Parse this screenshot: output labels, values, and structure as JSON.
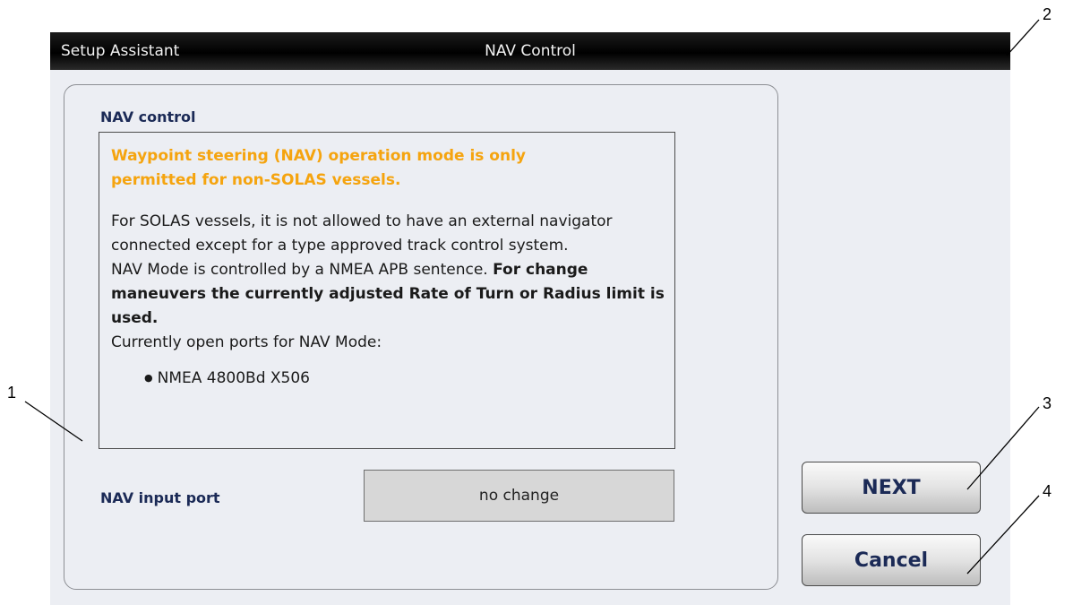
{
  "titlebar": {
    "left_title": "Setup Assistant",
    "center_title": "NAV Control"
  },
  "panel": {
    "section_title": "NAV control",
    "warning": "Waypoint steering (NAV) operation mode is only permitted for non-SOLAS vessels.",
    "paragraph1": "For SOLAS vessels, it is not allowed to have an external navigator connected except for a type approved track control system.",
    "paragraph2_normal": "NAV Mode is controlled by a NMEA APB sentence. ",
    "paragraph2_bold": "For change maneuvers the currently adjusted Rate of Turn or Radius limit is used.",
    "ports_heading": "Currently open ports for NAV Mode:",
    "ports": [
      "NMEA 4800Bd X506"
    ]
  },
  "input_port": {
    "label": "NAV input port",
    "value": "no change"
  },
  "buttons": {
    "next": "NEXT",
    "cancel": "Cancel"
  },
  "callouts": [
    "1",
    "2",
    "3",
    "4"
  ],
  "colors": {
    "warning": "#f5a40f",
    "label": "#1b2a56",
    "background": "#eceef3"
  }
}
